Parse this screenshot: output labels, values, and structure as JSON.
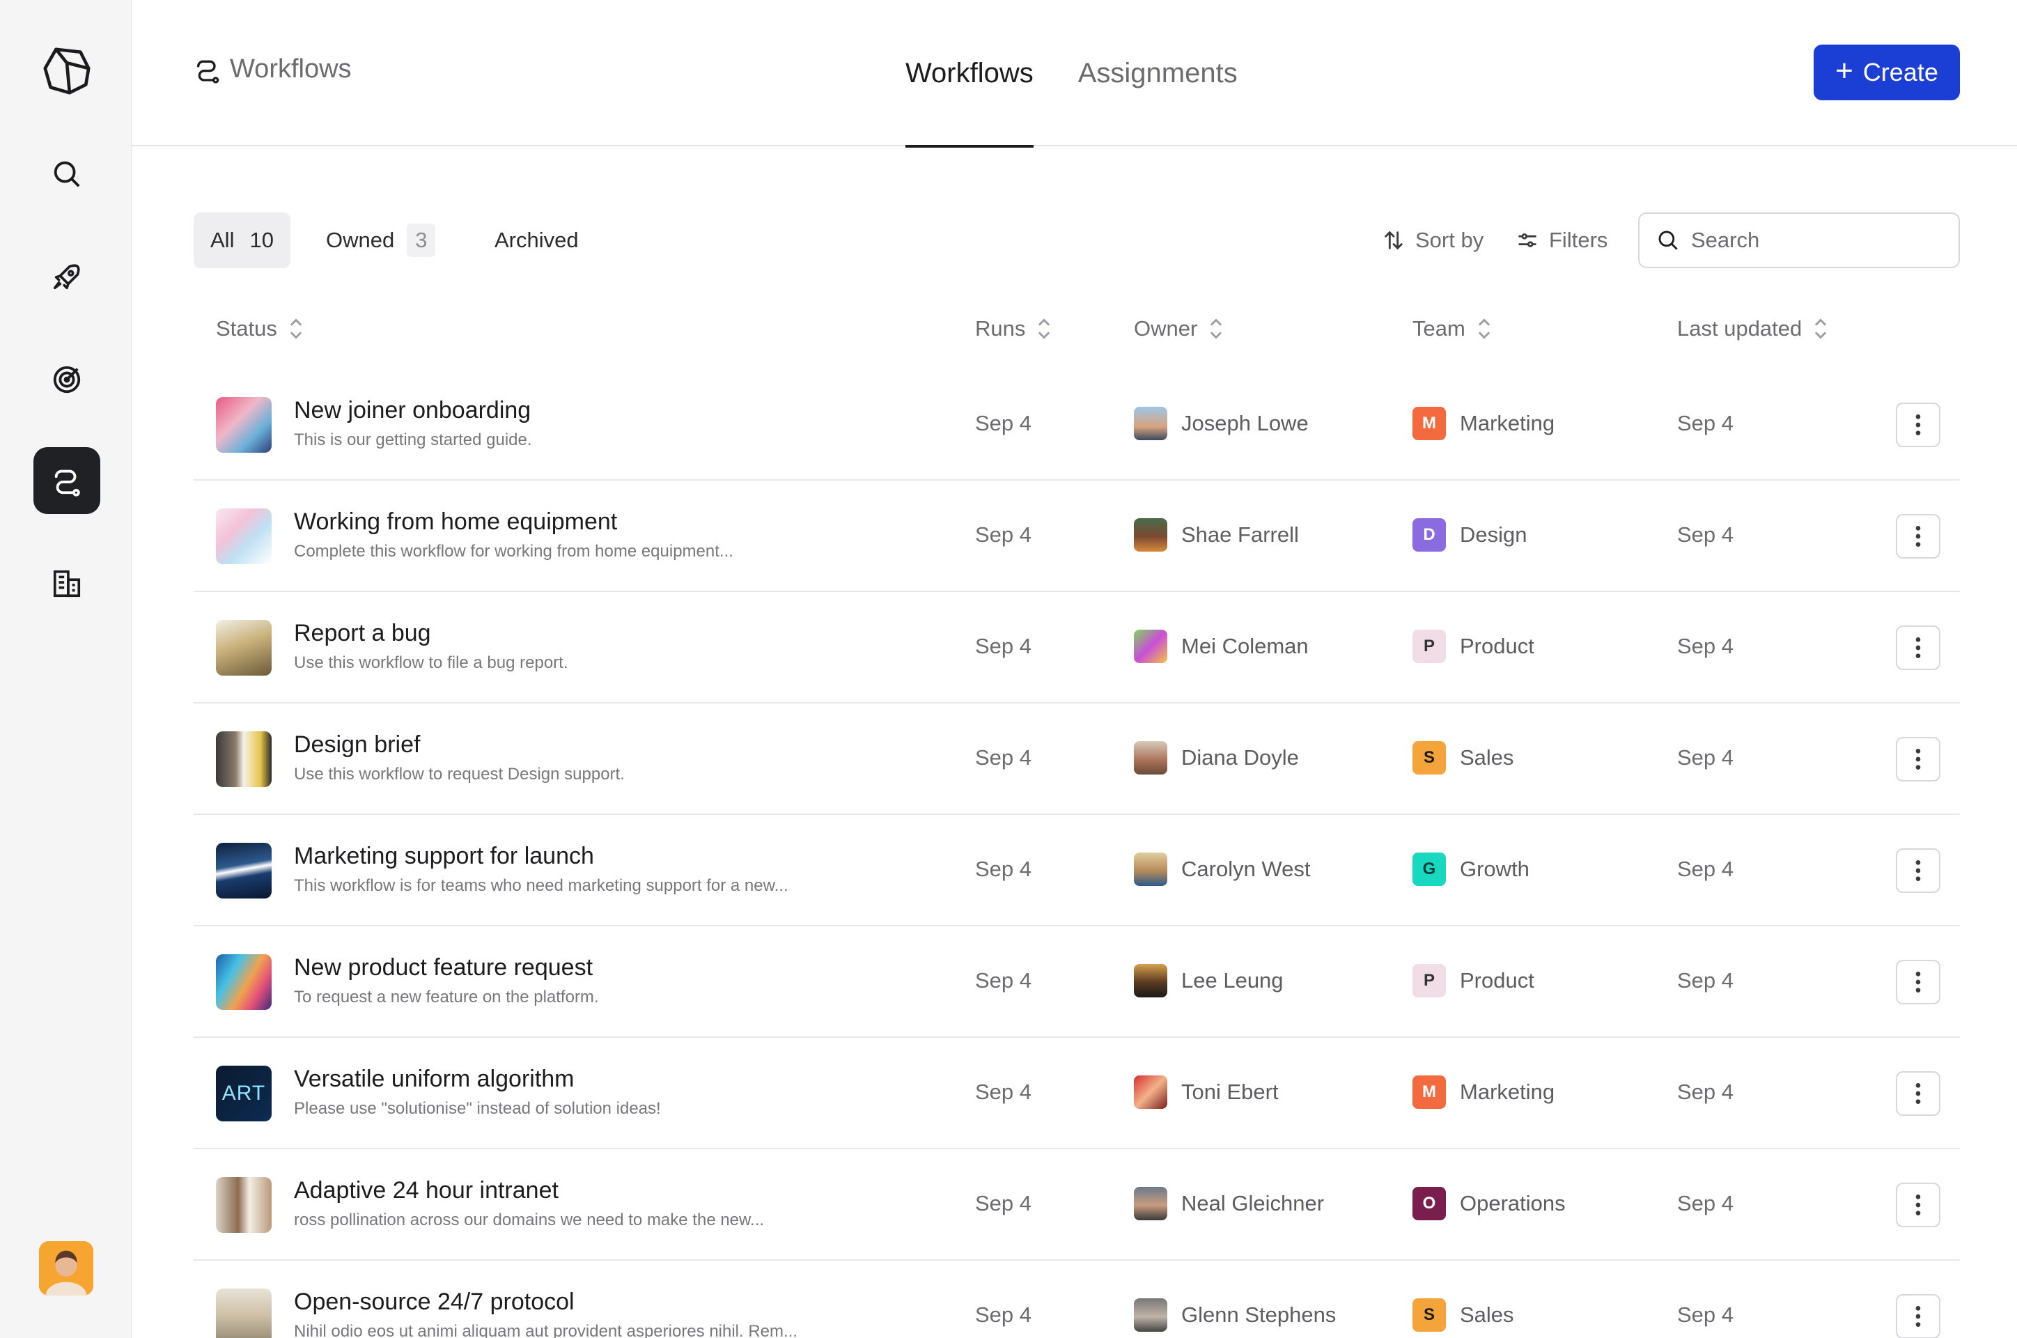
{
  "sidebar": {
    "items": [
      {
        "name": "logo",
        "icon": "app-logo-icon"
      },
      {
        "name": "search",
        "icon": "search-icon"
      },
      {
        "name": "launch",
        "icon": "rocket-icon"
      },
      {
        "name": "goals",
        "icon": "target-icon"
      },
      {
        "name": "workflows",
        "icon": "workflow-icon",
        "active": true
      },
      {
        "name": "organization",
        "icon": "building-icon"
      }
    ],
    "user_avatar": "user-avatar"
  },
  "header": {
    "breadcrumb": "Workflows",
    "tabs": [
      {
        "label": "Workflows",
        "active": true
      },
      {
        "label": "Assignments",
        "active": false
      }
    ],
    "create_label": "Create"
  },
  "filters": {
    "chips": [
      {
        "label": "All",
        "count": "10"
      },
      {
        "label": "Owned",
        "count": "3"
      },
      {
        "label": "Archived",
        "count": ""
      }
    ],
    "sort_label": "Sort by",
    "filters_label": "Filters",
    "search_placeholder": "Search"
  },
  "table": {
    "columns": [
      "Status",
      "Runs",
      "Owner",
      "Team",
      "Last updated"
    ],
    "rows": [
      {
        "title": "New joiner onboarding",
        "description": "This is our getting started guide.",
        "runs": "Sep 4",
        "owner": "Joseph Lowe",
        "team": "Marketing",
        "team_letter": "M",
        "updated": "Sep 4"
      },
      {
        "title": "Working from home equipment",
        "description": "Complete this workflow for working from home equipment...",
        "runs": "Sep 4",
        "owner": "Shae Farrell",
        "team": "Design",
        "team_letter": "D",
        "updated": "Sep 4"
      },
      {
        "title": "Report a bug",
        "description": "Use this workflow to file a bug report.",
        "runs": "Sep 4",
        "owner": "Mei Coleman",
        "team": "Product",
        "team_letter": "P",
        "updated": "Sep 4"
      },
      {
        "title": "Design brief",
        "description": "Use this workflow to request Design support.",
        "runs": "Sep 4",
        "owner": "Diana Doyle",
        "team": "Sales",
        "team_letter": "S",
        "updated": "Sep 4"
      },
      {
        "title": "Marketing support for launch",
        "description": "This workflow is for teams who need marketing support for a new...",
        "runs": "Sep 4",
        "owner": "Carolyn West",
        "team": "Growth",
        "team_letter": "G",
        "updated": "Sep 4"
      },
      {
        "title": "New product feature request",
        "description": "To request a new feature on the platform.",
        "runs": "Sep 4",
        "owner": "Lee Leung",
        "team": "Product",
        "team_letter": "P",
        "updated": "Sep 4"
      },
      {
        "title": "Versatile uniform algorithm",
        "description": "Please use \"solutionise\" instead of solution ideas!",
        "runs": "Sep 4",
        "owner": "Toni Ebert",
        "team": "Marketing",
        "team_letter": "M",
        "updated": "Sep 4"
      },
      {
        "title": "Adaptive 24 hour intranet",
        "description": "ross pollination across our domains we need to make the new...",
        "runs": "Sep 4",
        "owner": "Neal Gleichner",
        "team": "Operations",
        "team_letter": "O",
        "updated": "Sep 4"
      },
      {
        "title": "Open-source 24/7 protocol",
        "description": "Nihil odio eos ut animi aliquam aut provident asperiores nihil. Rem...",
        "runs": "Sep 4",
        "owner": "Glenn Stephens",
        "team": "Sales",
        "team_letter": "S",
        "updated": "Sep 4"
      }
    ]
  },
  "colors": {
    "accent": "#1b3fd4",
    "team_marketing": "#f26a3d",
    "team_design": "#8a6ce0",
    "team_product": "#f0dde6",
    "team_sales": "#f4a43a",
    "team_growth": "#18d9c0",
    "team_operations": "#7a1f4d"
  }
}
